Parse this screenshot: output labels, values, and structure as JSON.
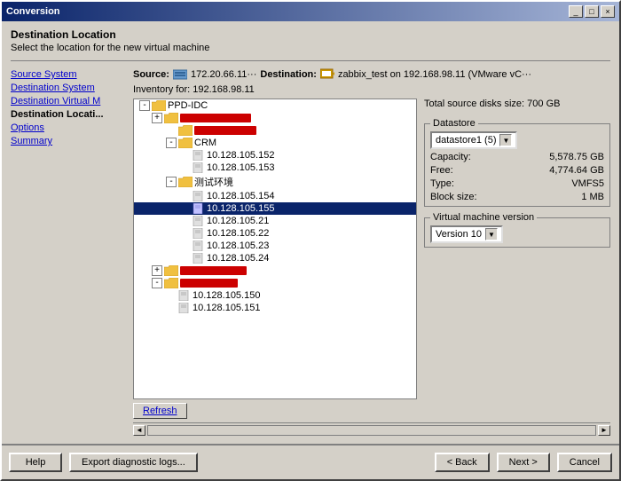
{
  "window": {
    "title": "Conversion",
    "title_buttons": [
      "_",
      "□",
      "×"
    ]
  },
  "page": {
    "title": "Destination Location",
    "subtitle": "Select the location for the new virtual machine"
  },
  "nav": {
    "items": [
      {
        "id": "source-system",
        "label": "Source System",
        "active": false
      },
      {
        "id": "destination-system",
        "label": "Destination System",
        "active": false
      },
      {
        "id": "destination-virtual-m",
        "label": "Destination Virtual M",
        "active": false
      },
      {
        "id": "destination-location",
        "label": "Destination Locati...",
        "active": true
      },
      {
        "id": "options",
        "label": "Options",
        "active": false
      },
      {
        "id": "summary",
        "label": "Summary",
        "active": false
      }
    ]
  },
  "source_dest_bar": {
    "source_label": "Source:",
    "source_icon": "server",
    "source_text": "172.20.66.11···",
    "dest_label": "Destination:",
    "dest_icon": "vm",
    "dest_text": "zabbix_test on 192.168.98.11 (VMware vC···"
  },
  "inventory_bar": {
    "label": "Inventory for:",
    "value": "192.168.98.11"
  },
  "tree": {
    "items": [
      {
        "id": "ppd-idc",
        "label": "PPD-IDC",
        "indent": 0,
        "type": "folder",
        "toggle": "-",
        "redacted": false
      },
      {
        "id": "redacted-1",
        "label": "",
        "indent": 1,
        "type": "folder",
        "toggle": "+",
        "redacted": true
      },
      {
        "id": "redacted-2",
        "label": "",
        "indent": 2,
        "type": "folder",
        "toggle": "",
        "redacted": true
      },
      {
        "id": "crm",
        "label": "CRM",
        "indent": 2,
        "type": "folder",
        "toggle": "-",
        "redacted": false
      },
      {
        "id": "ip-152",
        "label": "10.128.105.152",
        "indent": 3,
        "type": "doc",
        "toggle": "",
        "redacted": false
      },
      {
        "id": "ip-153",
        "label": "10.128.105.153",
        "indent": 3,
        "type": "doc",
        "toggle": "",
        "redacted": false
      },
      {
        "id": "test-env",
        "label": "测试环境",
        "indent": 2,
        "type": "folder",
        "toggle": "-",
        "redacted": false
      },
      {
        "id": "ip-154",
        "label": "10.128.105.154",
        "indent": 3,
        "type": "doc",
        "toggle": "",
        "redacted": false
      },
      {
        "id": "ip-155",
        "label": "10.128.105.155",
        "indent": 3,
        "type": "doc",
        "toggle": "",
        "selected": true,
        "redacted": false
      },
      {
        "id": "ip-21",
        "label": "10.128.105.21",
        "indent": 3,
        "type": "doc",
        "toggle": "",
        "redacted": false
      },
      {
        "id": "ip-22",
        "label": "10.128.105.22",
        "indent": 3,
        "type": "doc",
        "toggle": "",
        "redacted": false
      },
      {
        "id": "ip-23",
        "label": "10.128.105.23",
        "indent": 3,
        "type": "doc",
        "toggle": "",
        "redacted": false
      },
      {
        "id": "ip-24",
        "label": "10.128.105.24",
        "indent": 3,
        "type": "doc",
        "toggle": "",
        "redacted": false
      },
      {
        "id": "redacted-3",
        "label": "",
        "indent": 1,
        "type": "folder",
        "toggle": "+",
        "redacted": true
      },
      {
        "id": "redacted-4",
        "label": "",
        "indent": 1,
        "type": "folder",
        "toggle": "-",
        "redacted": true
      },
      {
        "id": "ip-150",
        "label": "10.128.105.150",
        "indent": 2,
        "type": "doc",
        "toggle": "",
        "redacted": false
      },
      {
        "id": "ip-151",
        "label": "10.128.105.151",
        "indent": 2,
        "type": "doc",
        "toggle": "",
        "redacted": false
      }
    ]
  },
  "info_panel": {
    "total_size_label": "Total source disks size:",
    "total_size_value": "700 GB",
    "datastore": {
      "title": "Datastore",
      "select_label": "datastore1 (5)",
      "rows": [
        {
          "label": "Capacity:",
          "value": "5,578.75 GB"
        },
        {
          "label": "Free:",
          "value": "4,774.64 GB"
        },
        {
          "label": "Type:",
          "value": "VMFS5"
        },
        {
          "label": "Block size:",
          "value": "1 MB"
        }
      ]
    },
    "vm_version": {
      "title": "Virtual machine version",
      "select_label": "Version 10"
    }
  },
  "refresh_btn": "Refresh",
  "footer": {
    "help_label": "Help",
    "export_label": "Export diagnostic logs...",
    "back_label": "< Back",
    "next_label": "Next >",
    "cancel_label": "Cancel"
  }
}
